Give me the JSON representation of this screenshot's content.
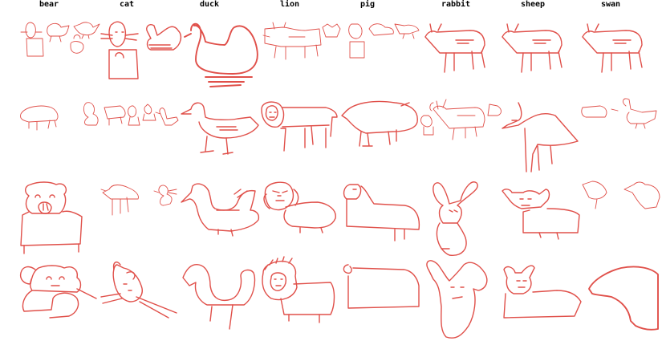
{
  "columns": [
    "bear",
    "cat",
    "duck",
    "lion",
    "pig",
    "rabbit",
    "sheep",
    "swan"
  ],
  "stroke_color": "#e0504a"
}
